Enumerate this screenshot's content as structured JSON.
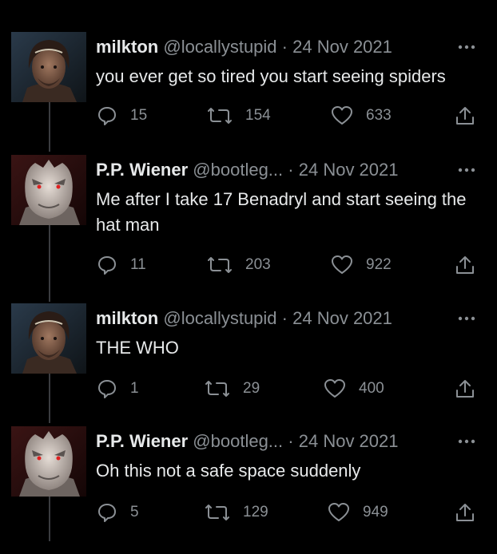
{
  "tweets": [
    {
      "avatar": "milkton-avatar",
      "name": "milkton",
      "handle": "@locallystupid",
      "separator": "·",
      "date": "24 Nov 2021",
      "text": "you ever get so tired you start seeing spiders",
      "replies": "15",
      "retweets": "154",
      "likes": "633"
    },
    {
      "avatar": "pp-wiener-avatar",
      "name": "P.P. Wiener",
      "handle": "@bootleg...",
      "separator": "·",
      "date": "24 Nov 2021",
      "text": "Me after I take 17 Benadryl and start seeing the hat man",
      "replies": "11",
      "retweets": "203",
      "likes": "922"
    },
    {
      "avatar": "milkton-avatar",
      "name": "milkton",
      "handle": "@locallystupid",
      "separator": "·",
      "date": "24 Nov 2021",
      "text": "THE WHO",
      "replies": "1",
      "retweets": "29",
      "likes": "400"
    },
    {
      "avatar": "pp-wiener-avatar",
      "name": "P.P. Wiener",
      "handle": "@bootleg...",
      "separator": "·",
      "date": "24 Nov 2021",
      "text": "Oh this not a safe space suddenly",
      "replies": "5",
      "retweets": "129",
      "likes": "949"
    }
  ],
  "icons": {
    "reply": "reply-icon",
    "retweet": "retweet-icon",
    "like": "heart-icon",
    "share": "share-icon",
    "more": "more-icon"
  },
  "colors": {
    "background": "#000000",
    "text": "#e7e9ea",
    "muted": "#8b9095",
    "thread_line": "#3a3c40"
  }
}
